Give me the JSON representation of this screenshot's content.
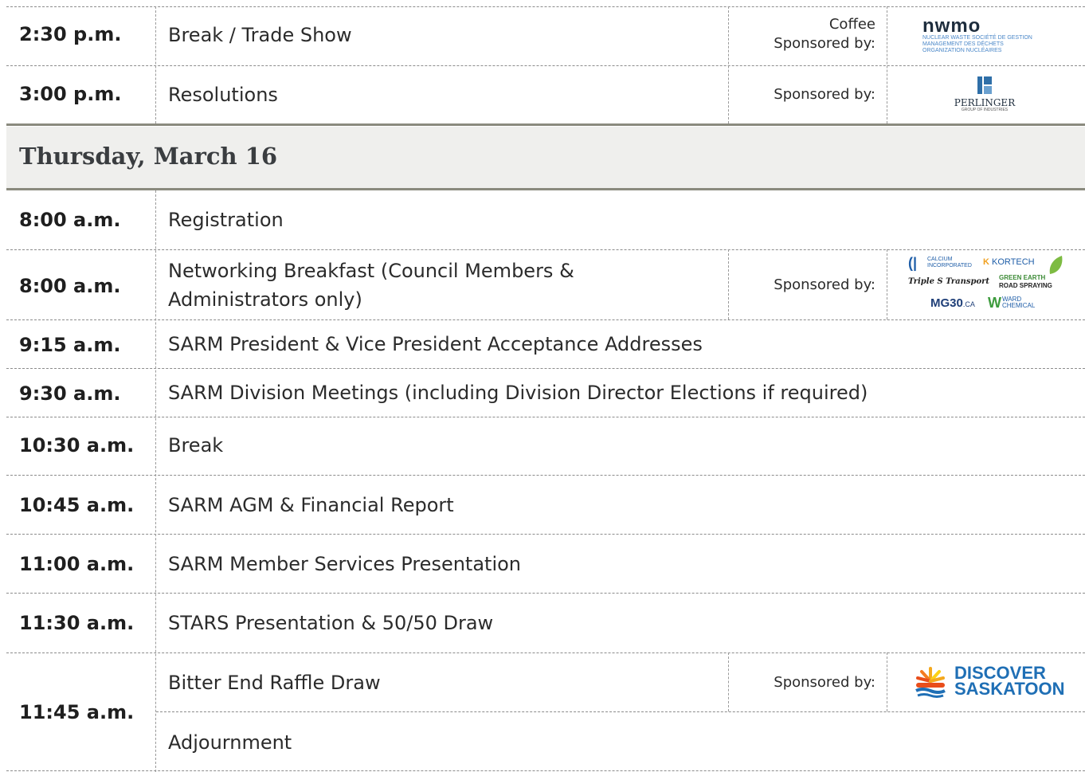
{
  "rows_before": [
    {
      "time": "2:30 p.m.",
      "event": "Break / Trade Show",
      "sponsor_top": "Coffee",
      "sponsor_label": "Sponsored by:"
    },
    {
      "time": "3:00 p.m.",
      "event": "Resolutions",
      "sponsor_label": "Sponsored by:"
    }
  ],
  "day_header": "Thursday, March 16",
  "rows": [
    {
      "time": "8:00 a.m.",
      "event": "Registration"
    },
    {
      "time": "8:00 a.m.",
      "event": "Networking Breakfast (Council Members &",
      "event_line2": "Administrators only)",
      "sponsor_label": "Sponsored by:"
    },
    {
      "time": "9:15 a.m.",
      "event": "SARM President & Vice President Acceptance Addresses"
    },
    {
      "time": "9:30 a.m.",
      "event": "SARM Division Meetings (including Division Director Elections if required)"
    },
    {
      "time": "10:30 a.m.",
      "event": "Break"
    },
    {
      "time": "10:45 a.m.",
      "event": "SARM AGM & Financial Report"
    },
    {
      "time": "11:00 a.m.",
      "event": "SARM Member Services Presentation"
    },
    {
      "time": "11:30 a.m.",
      "event": "STARS Presentation & 50/50 Draw"
    },
    {
      "time": "11:45 a.m.",
      "event": "Bitter End Raffle Draw",
      "event_b": "Adjournment",
      "sponsor_label": "Sponsored by:"
    }
  ],
  "logos": {
    "nwmo": {
      "name": "nwmo",
      "sub1": "NUCLEAR WASTE   SOCIÉTÉ DE GESTION",
      "sub2": "MANAGEMENT      DES DÉCHETS",
      "sub3": "ORGANIZATION    NUCLÉAIRES"
    },
    "perlinger": {
      "name": "PERLINGER",
      "sub": "GROUP OF INDUSTRIES"
    },
    "breakfast": {
      "calcium_1": "CALCIUM",
      "calcium_2": "INCORPORATED",
      "kortech": "KORTECH",
      "triple_s": "Triple S Transport",
      "green_earth_1": "GREEN EARTH",
      "green_earth_2": "ROAD SPRAYING",
      "mg30": "MG30",
      "mg30_suffix": ".CA",
      "ward_1": "WARD",
      "ward_2": "CHEMICAL"
    },
    "discover": {
      "line1": "DISCOVER",
      "line2": "SASKATOON"
    }
  },
  "colors": {
    "rule": "#8a8a7e",
    "header_bg": "#efefed",
    "nwmo_blue": "#4a87c8",
    "nwmo_dark": "#1e2d3d",
    "discover_blue": "#1f6fb5"
  }
}
